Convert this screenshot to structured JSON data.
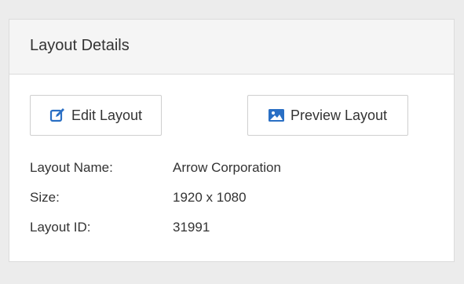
{
  "panel": {
    "title": "Layout Details"
  },
  "actions": {
    "edit_label": "Edit Layout",
    "preview_label": "Preview Layout",
    "edit_icon": "edit-icon",
    "preview_icon": "image-icon"
  },
  "details": [
    {
      "label": "Layout Name:",
      "value": "Arrow Corporation"
    },
    {
      "label": "Size:",
      "value": "1920 x 1080"
    },
    {
      "label": "Layout ID:",
      "value": "31991"
    }
  ],
  "colors": {
    "accent": "#2a6fc4",
    "page_bg": "#ececec",
    "header_bg": "#f5f5f5"
  }
}
